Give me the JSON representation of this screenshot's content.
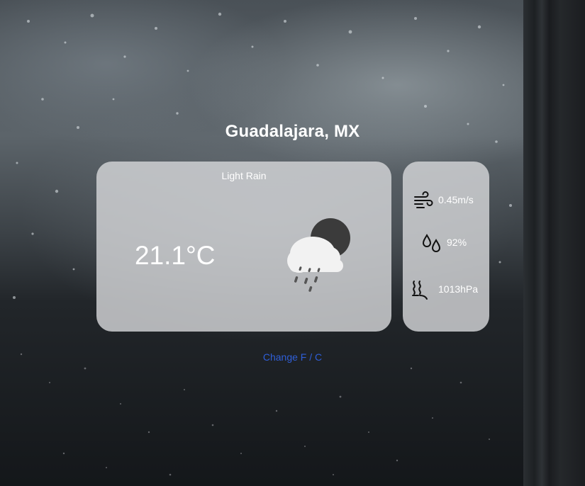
{
  "location": {
    "city": "Guadalajara, MX"
  },
  "current": {
    "condition": "Light Rain",
    "temperature": "21.1°C",
    "icon": "cloud-sun-rain-icon"
  },
  "details": {
    "wind": {
      "icon": "wind-icon",
      "value": "0.45m/s"
    },
    "humidity": {
      "icon": "droplets-icon",
      "value": "92%"
    },
    "pressure": {
      "icon": "pressure-waves-icon",
      "value": "1013hPa"
    }
  },
  "controls": {
    "unit_toggle_label": "Change F / C"
  },
  "colors": {
    "link": "#2f5fd8",
    "card": "#d4d6d8",
    "text": "#ffffff"
  }
}
